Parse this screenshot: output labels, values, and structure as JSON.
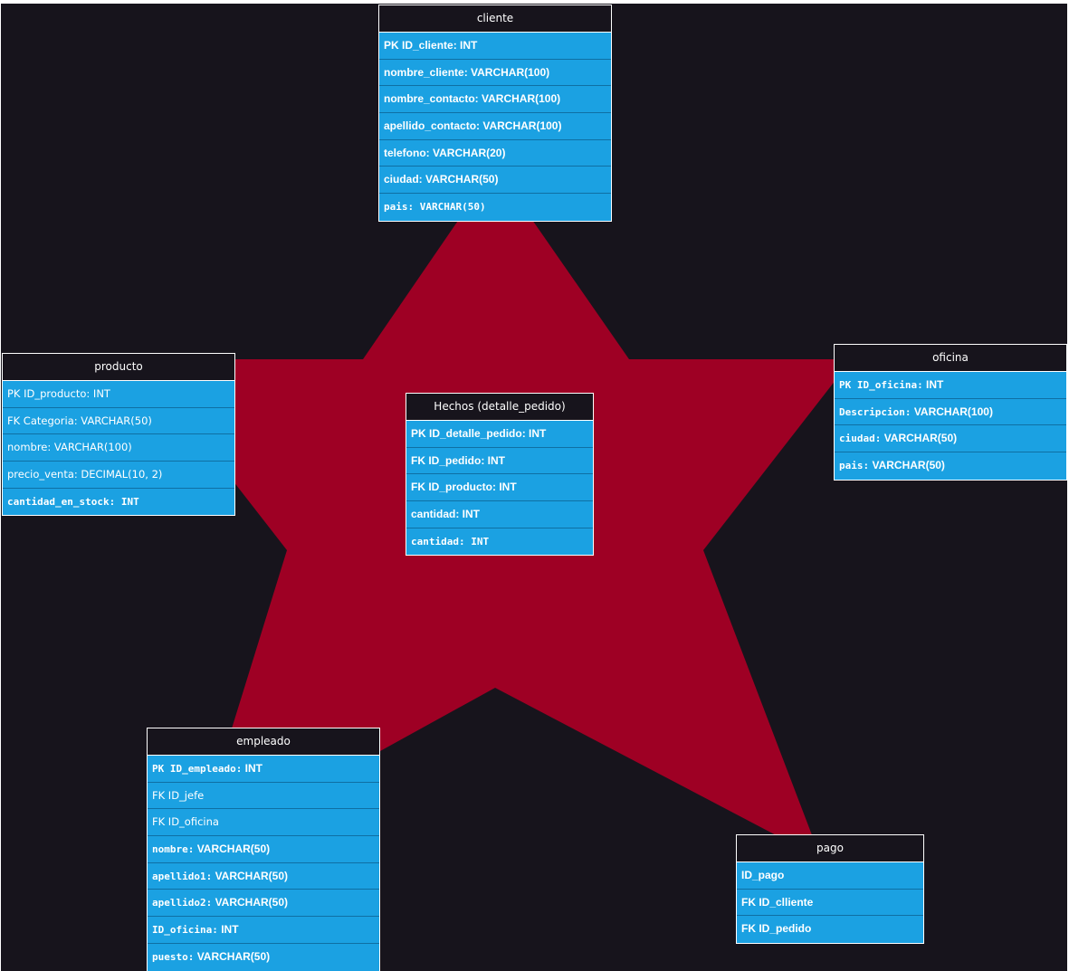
{
  "colors": {
    "background": "#17141c",
    "star": "#9e0024",
    "entity_header": "#17141c",
    "entity_row": "#1ba1e2",
    "text": "#ffffff"
  },
  "entities": {
    "cliente": {
      "title": "cliente",
      "rows": [
        "PK ID_cliente: INT",
        "nombre_cliente: VARCHAR(100)",
        "nombre_contacto: VARCHAR(100)",
        "apellido_contacto: VARCHAR(100)",
        "telefono: VARCHAR(20)",
        "ciudad: VARCHAR(50)",
        "pais:  VARCHAR(50)"
      ]
    },
    "producto": {
      "title": "producto",
      "rows": [
        "PK ID_producto: INT",
        "FK Categoria: VARCHAR(50)",
        "nombre: VARCHAR(100)",
        "precio_venta: DECIMAL(10, 2)",
        "cantidad_en_stock:  INT"
      ]
    },
    "hechos": {
      "title": "Hechos (detalle_pedido)",
      "rows": [
        "PK ID_detalle_pedido: INT",
        "FK ID_pedido: INT",
        "FK ID_producto: INT",
        "cantidad: INT",
        "cantidad:  INT"
      ]
    },
    "oficina": {
      "title": "oficina",
      "rows": [
        {
          "mono": "PK  ID_oficina:",
          "rest": " INT"
        },
        {
          "mono": "Descripcion:",
          "rest": " VARCHAR(100)"
        },
        {
          "mono": "ciudad:",
          "rest": " VARCHAR(50)"
        },
        {
          "mono": "pais:",
          "rest": " VARCHAR(50)"
        }
      ]
    },
    "empleado": {
      "title": "empleado",
      "rows": [
        {
          "mono": "PK  ID_empleado:",
          "rest": " INT"
        },
        "FK ID_jefe",
        "FK ID_oficina",
        {
          "mono": "nombre:",
          "rest": " VARCHAR(50)"
        },
        {
          "mono": "apellido1:",
          "rest": " VARCHAR(50)"
        },
        {
          "mono": "apellido2:",
          "rest": " VARCHAR(50)"
        },
        {
          "mono": "ID_oficina:",
          "rest": " INT"
        },
        {
          "mono": "puesto:",
          "rest": " VARCHAR(50)"
        }
      ]
    },
    "pago": {
      "title": "pago",
      "rows": [
        "ID_pago",
        "FK ID_clliente",
        "FK ID_pedido"
      ]
    }
  }
}
